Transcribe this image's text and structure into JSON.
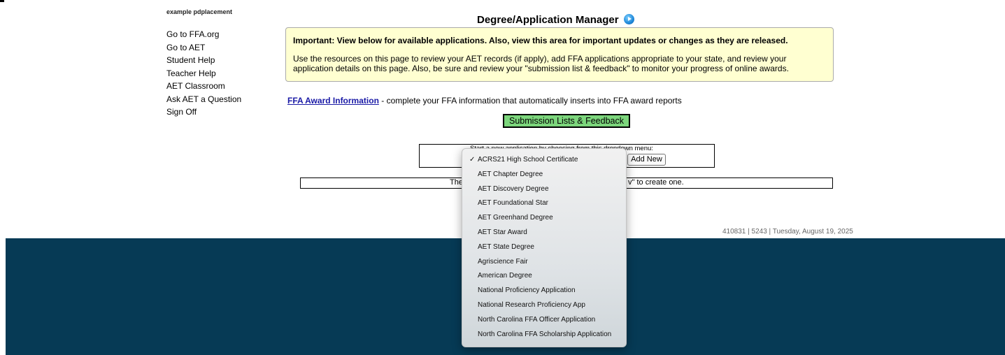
{
  "header": {
    "user_line": "example pdplacement",
    "page_title": "Degree/Application Manager"
  },
  "nav": {
    "items": [
      "Go to FFA.org",
      "Go to AET",
      "Student Help",
      "Teacher Help",
      "AET Classroom",
      "Ask AET a Question",
      "Sign Off"
    ]
  },
  "notice": {
    "title": "Important: View below for available applications. Also, view this area for important updates or changes as they are released.",
    "body": "Use the resources on this page to review your AET records (if apply), add FFA applications appropriate to your state, and review your application details on this page. Also, be sure and review your \"submission list & feedback\" to monitor your progress of online awards."
  },
  "ffa": {
    "link_label": "FFA Award Information",
    "description": " - complete your FFA information that automatically inserts into FFA award reports"
  },
  "submission_button": "Submission Lists & Feedback",
  "start": {
    "prompt": "Start a new application by choosing from this dropdown menu:",
    "add_button": "Add New"
  },
  "empty_message": {
    "left_fragment": "The",
    "right_fragment": "v\" to create one."
  },
  "dropdown": {
    "selected_mark": "✓",
    "options": [
      "ACRS21 High School Certificate",
      "AET Chapter Degree",
      "AET Discovery Degree",
      "AET Foundational Star",
      "AET Greenhand Degree",
      "AET Star Award",
      "AET State Degree",
      "Agriscience Fair",
      "American Degree",
      "National Proficiency Application",
      "National Research Proficiency App",
      "North Carolina FFA Officer Application",
      "North Carolina FFA Scholarship Application"
    ],
    "selected_index": 0
  },
  "status_stamp": "410831 | 5243 | Tuesday, August 19, 2025",
  "colors": {
    "notice_bg": "#ffffd1",
    "submission_button_bg": "#7cd67c",
    "footer_bg": "#063a55",
    "link": "#1a1aa6"
  }
}
